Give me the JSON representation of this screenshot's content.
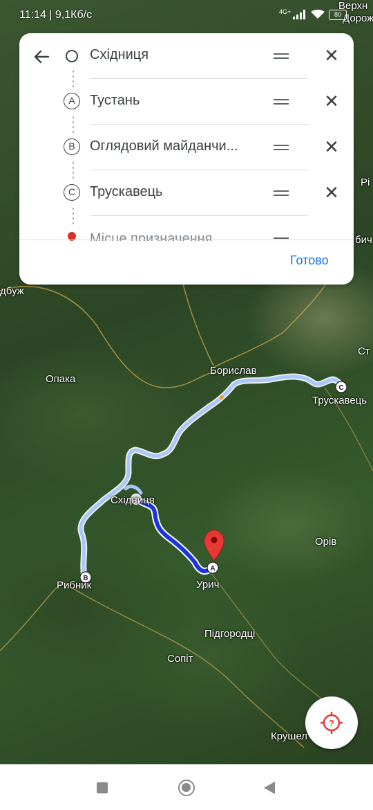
{
  "status_bar": {
    "time": "11:14 | 9,1Кб/с",
    "network": "4G+",
    "battery": "80"
  },
  "card": {
    "back_label": "←",
    "rows": [
      {
        "marker": "",
        "name": "Східниця"
      },
      {
        "marker": "A",
        "name": "Тустань"
      },
      {
        "marker": "B",
        "name": "Оглядовий майданчи..."
      },
      {
        "marker": "C",
        "name": "Трускавець"
      }
    ],
    "remove_glyph": "✕",
    "partial_row_name": "Місце призначення",
    "done_label": "Готово"
  },
  "map_labels": {
    "boryslav": "Борислав",
    "truskavets": "Трускавець",
    "opaka": "Опака",
    "skhidnytsia": "Східниця",
    "oriv": "Орів",
    "urych": "Урич",
    "rybnyk": "Рибник",
    "pidhorodtsi": "Підгородці",
    "sopit": "Сопіт",
    "krushel": "Крушел",
    "dbuzh": "дбуж",
    "verkhn": "Верхн",
    "dorozh": "Дорож",
    "ri": "Рі",
    "bych": "бич",
    "st": "Ст"
  },
  "route_markers": {
    "a": "A",
    "b": "B",
    "c": "C"
  },
  "colors": {
    "primary_route": "#1a35e0",
    "alt_route": "#a8c7fa",
    "accent": "#1a73e8",
    "pin": "#e53935"
  },
  "icons": [
    "arrow-back-icon",
    "drag-handle-icon",
    "close-icon",
    "location-pin-icon",
    "my-location-icon"
  ]
}
